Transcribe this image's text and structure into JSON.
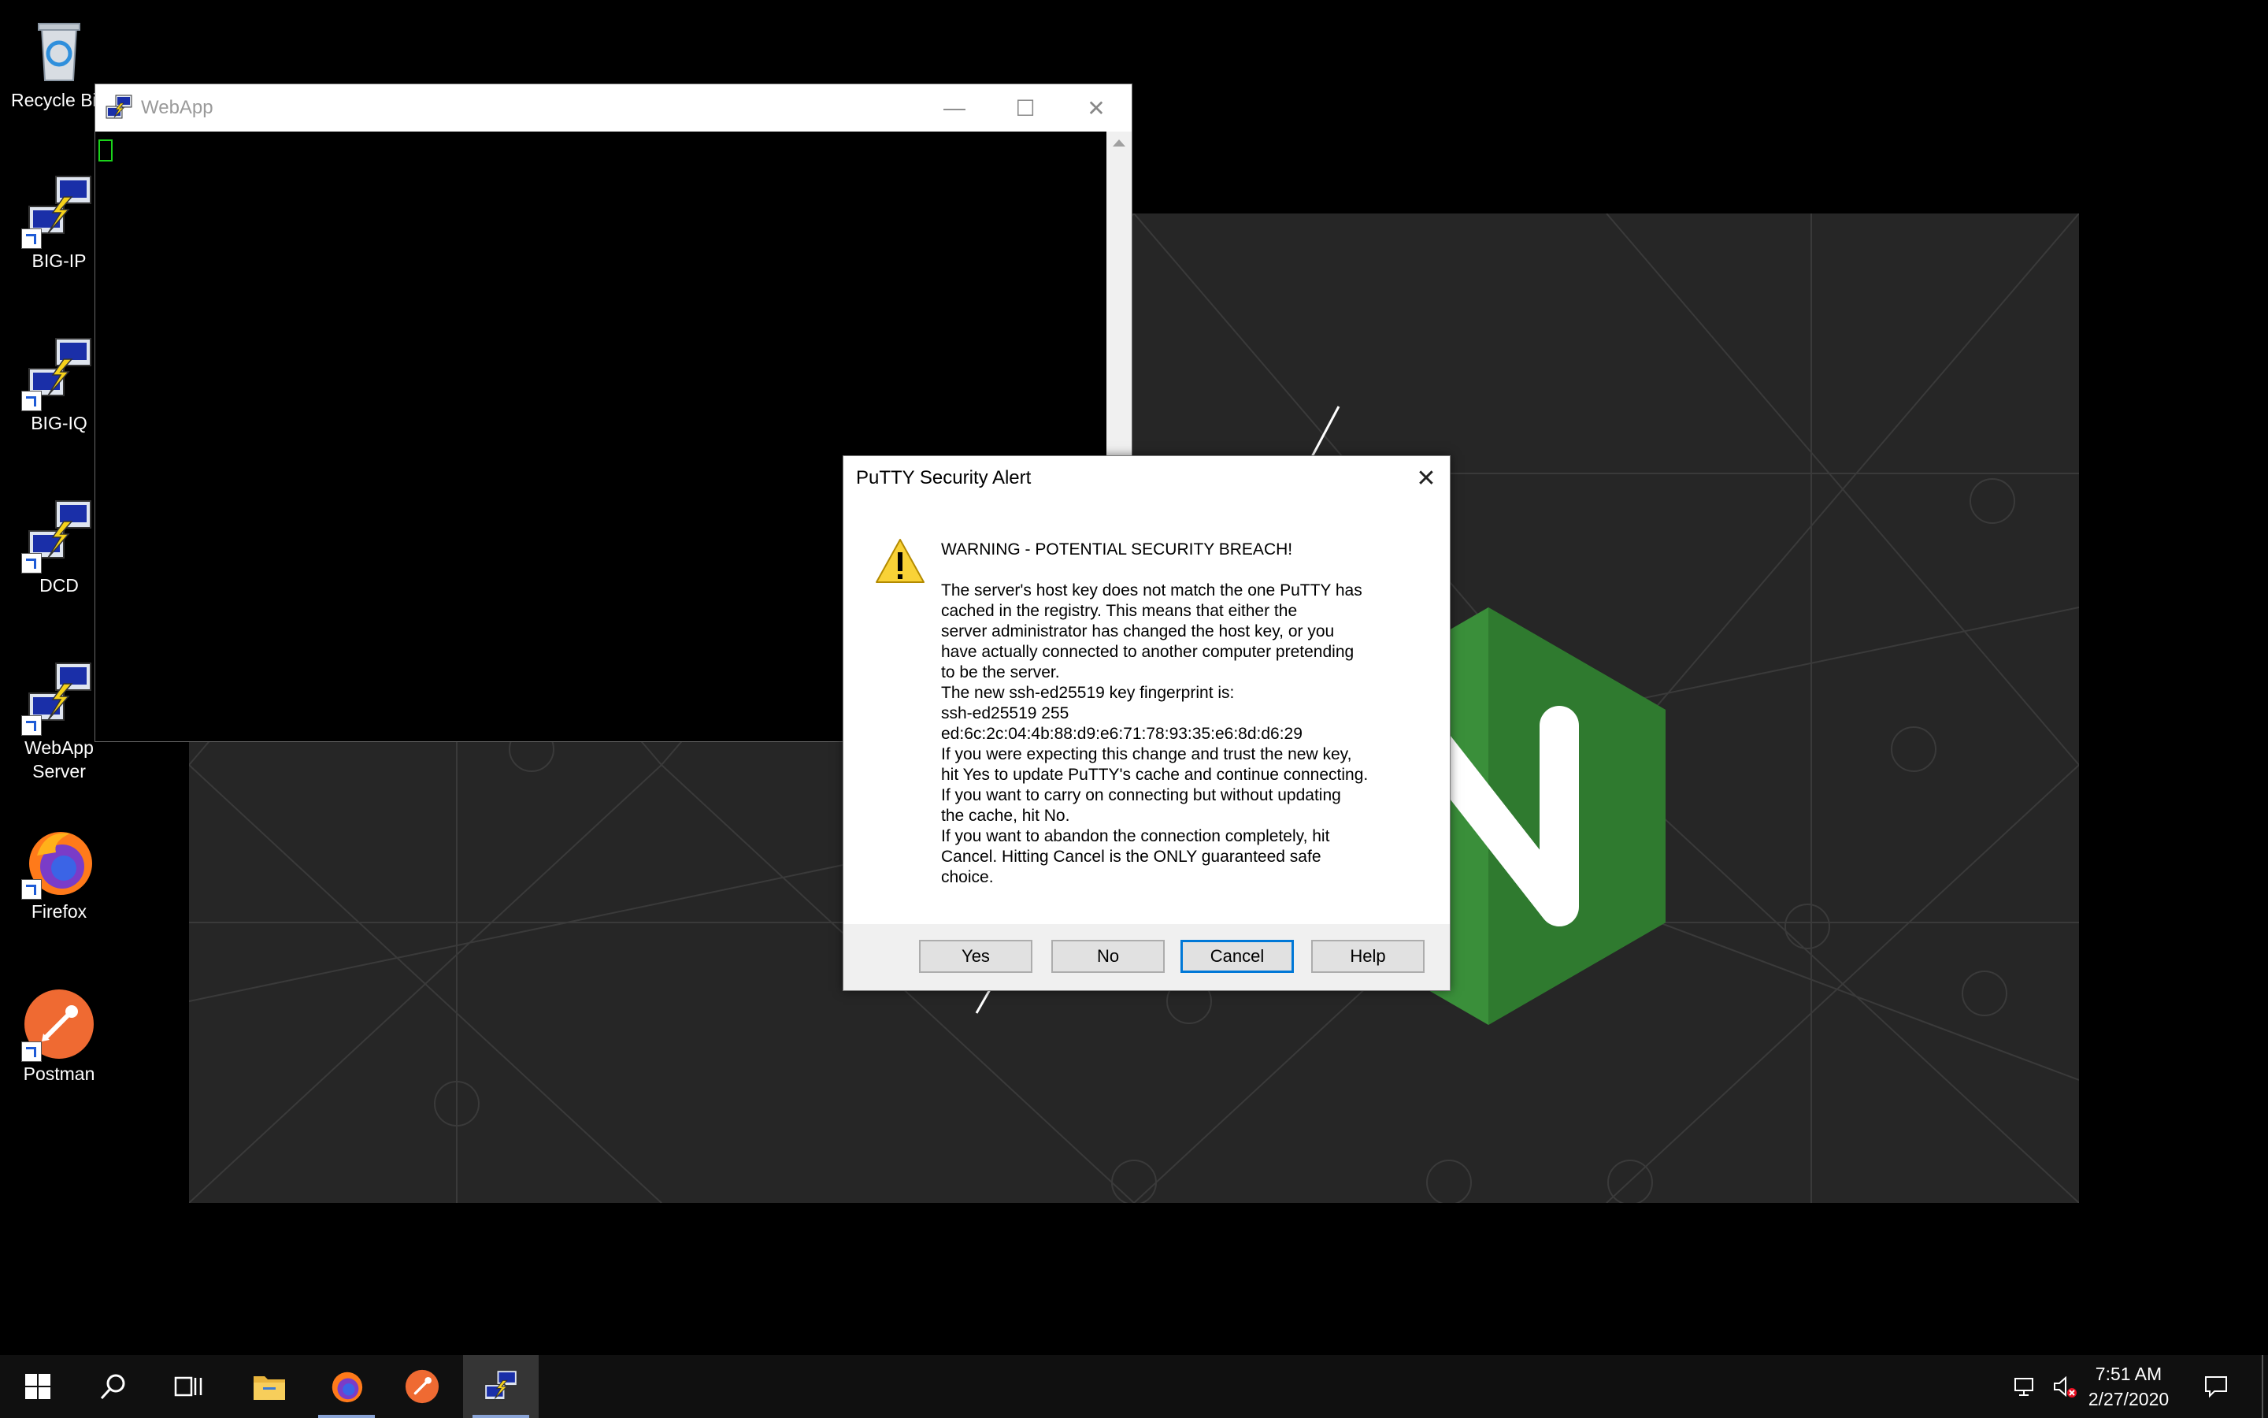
{
  "desktop": {
    "icons": [
      {
        "label": "Recycle Bin",
        "icon": "recycle-bin-icon"
      },
      {
        "label": "BIG-IP",
        "icon": "putty-icon"
      },
      {
        "label": "BIG-IQ",
        "icon": "putty-icon"
      },
      {
        "label": "DCD",
        "icon": "putty-icon"
      },
      {
        "label": "WebApp\nServer",
        "icon": "putty-icon"
      },
      {
        "label": "Firefox",
        "icon": "firefox-icon"
      },
      {
        "label": "Postman",
        "icon": "postman-icon"
      }
    ]
  },
  "putty_window": {
    "title": "WebApp",
    "minimize": "—",
    "maximize": "☐",
    "close": "✕"
  },
  "dialog": {
    "title": "PuTTY Security Alert",
    "close": "✕",
    "heading": "WARNING - POTENTIAL SECURITY BREACH!",
    "lines": [
      "The server's host key does not match the one PuTTY has",
      "cached in the registry. This means that either the",
      "server administrator has changed the host key, or you",
      "have actually connected to another computer pretending",
      "to be the server.",
      "The new ssh-ed25519 key fingerprint is:",
      "ssh-ed25519 255",
      "ed:6c:2c:04:4b:88:d9:e6:71:78:93:35:e6:8d:d6:29",
      "If you were expecting this change and trust the new key,",
      "hit Yes to update PuTTY's cache and continue connecting.",
      "If you want to carry on connecting but without updating",
      "the cache, hit No.",
      "If you want to abandon the connection completely, hit",
      "Cancel. Hitting Cancel is the ONLY guaranteed safe",
      "choice."
    ],
    "buttons": {
      "yes": "Yes",
      "no": "No",
      "cancel": "Cancel",
      "help": "Help"
    }
  },
  "taskbar": {
    "items": [
      "start-icon",
      "search-icon",
      "task-view-icon",
      "file-explorer-icon",
      "firefox-icon",
      "postman-icon",
      "putty-icon"
    ],
    "time": "7:51 AM",
    "date": "2/27/2020"
  },
  "colors": {
    "wallpaper": "#262626",
    "nginx_green": "#3a8f3a",
    "f5_red": "#d42a2a",
    "accent": "#0078d7",
    "terminal_cursor": "#1bd41b"
  }
}
